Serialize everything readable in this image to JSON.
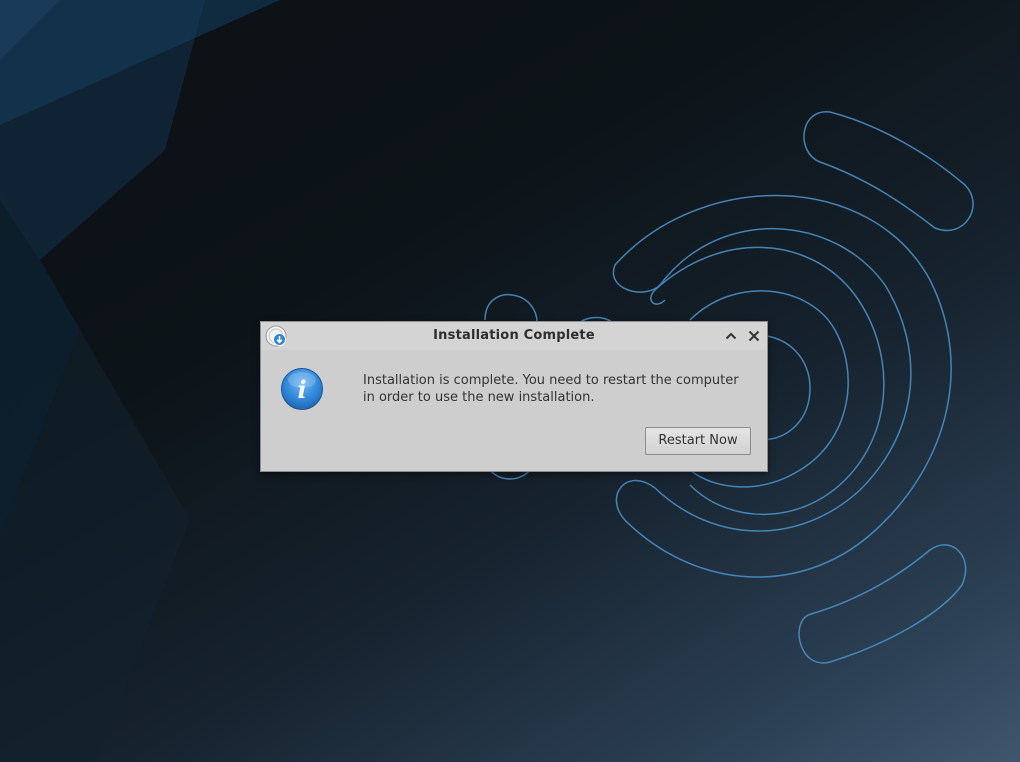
{
  "wallpaper": {
    "name": "desktop-wallpaper",
    "accent_color": "#4a8fc4"
  },
  "dialog": {
    "title": "Installation Complete",
    "app_icon": "installer-download-icon",
    "icon": "information-icon",
    "message_line1": "Installation is complete. You need to restart the computer",
    "message_line2": "in order to use the new installation.",
    "restart_label": "Restart Now",
    "controls": {
      "shade_icon": "chevron-up-icon",
      "close_icon": "close-icon"
    }
  },
  "colors": {
    "dialog_bg": "#cecece",
    "info_blue": "#2f86d8",
    "text": "#333333"
  }
}
